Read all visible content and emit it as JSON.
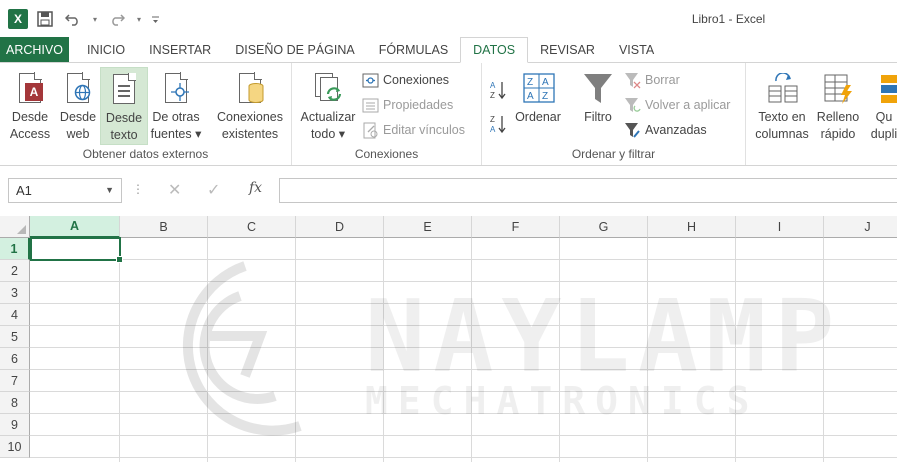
{
  "title_bar": {
    "app_icon": "X",
    "window_title": "Libro1 - Excel"
  },
  "tabs": [
    {
      "label": "ARCHIVO"
    },
    {
      "label": "INICIO"
    },
    {
      "label": "INSERTAR"
    },
    {
      "label": "DISEÑO DE PÁGINA"
    },
    {
      "label": "FÓRMULAS"
    },
    {
      "label": "DATOS"
    },
    {
      "label": "REVISAR"
    },
    {
      "label": "VISTA"
    }
  ],
  "ribbon": {
    "obtener": {
      "label": "Obtener datos externos",
      "access": [
        "Desde",
        "Access"
      ],
      "web": [
        "Desde",
        "web"
      ],
      "texto": [
        "Desde",
        "texto"
      ],
      "otras": [
        "De otras",
        "fuentes ▾"
      ],
      "existentes": [
        "Conexiones",
        "existentes"
      ]
    },
    "conexiones": {
      "label": "Conexiones",
      "actualizar": [
        "Actualizar",
        "todo ▾"
      ],
      "conexiones": "Conexiones",
      "propiedades": "Propiedades",
      "editar": "Editar vínculos"
    },
    "ordenar": {
      "label": "Ordenar y filtrar",
      "ordenar": "Ordenar",
      "filtro": "Filtro",
      "borrar": "Borrar",
      "volver": "Volver a aplicar",
      "avanzadas": "Avanzadas"
    },
    "herramientas": {
      "texto_cols": [
        "Texto en",
        "columnas"
      ],
      "relleno": [
        "Relleno",
        "rápido"
      ],
      "quitar": [
        "Qu",
        "dupli"
      ]
    }
  },
  "formula_bar": {
    "name_box": "A1",
    "fx": "fx",
    "value": ""
  },
  "grid": {
    "columns": [
      "A",
      "B",
      "C",
      "D",
      "E",
      "F",
      "G",
      "H",
      "I",
      "J"
    ],
    "rows": [
      "1",
      "2",
      "3",
      "4",
      "5",
      "6",
      "7",
      "8",
      "9",
      "10"
    ],
    "selected": "A1"
  },
  "watermark": {
    "line1": "NAYLAMP",
    "line2": "MECHATRONICS"
  },
  "colors": {
    "accent": "#217346",
    "selected_button": "#d5e8d4"
  }
}
